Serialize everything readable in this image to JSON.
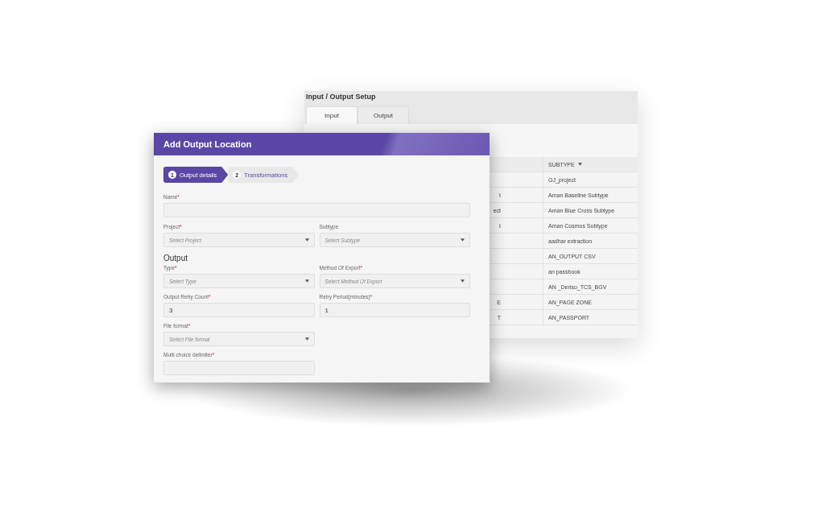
{
  "back_window": {
    "title": "Input / Output Setup",
    "tabs": [
      {
        "label": "Input",
        "selected": true
      },
      {
        "label": "Output",
        "selected": false
      }
    ],
    "table": {
      "subtype_header": "SUBTYPE",
      "rows": [
        {
          "subtype": "GJ_project"
        },
        {
          "column_1": "t",
          "subtype": "Aman Baseline Subtype"
        },
        {
          "column_1": "ect",
          "subtype": "Aman Blue Cross Subtype"
        },
        {
          "column_1": "t",
          "subtype": "Aman Cosmos Subtype"
        },
        {
          "subtype": "aadhar extraction"
        },
        {
          "subtype": "AN_OUTPUT CSV"
        },
        {
          "subtype": "an passbook"
        },
        {
          "subtype": "AN _Deriso_TCS_BGV"
        },
        {
          "column_1": "E",
          "subtype": "AN_PAGE ZONE"
        },
        {
          "column_1": "T",
          "subtype": "AN_PASSPORT"
        }
      ]
    }
  },
  "dialog": {
    "title": "Add Output Location",
    "steps": [
      {
        "number": "1",
        "label": "Output details",
        "selected": true
      },
      {
        "number": "2",
        "label": "Transformations",
        "selected": false
      }
    ],
    "sections": [
      {
        "fields": [
          {
            "kind": "wide_text",
            "label": "Name",
            "required_mark": "*"
          }
        ]
      },
      {
        "fields": [
          {
            "kind": "select",
            "label": "Project",
            "required_mark": "*",
            "placeholder": "Select Project"
          },
          {
            "kind": "select",
            "label": "Subtype",
            "placeholder": "Select Subtype"
          }
        ]
      },
      {
        "heading": "Output",
        "fields": [
          {
            "kind": "select",
            "label": "Type",
            "required_mark": "*",
            "placeholder": "Select Type"
          },
          {
            "kind": "select",
            "label": "Method Of Export",
            "required_mark": "*",
            "placeholder": "Select Method Of Export"
          },
          {
            "kind": "text",
            "label": "Output Retry Count",
            "required_mark": "*",
            "value": "3"
          },
          {
            "kind": "text",
            "label": "Retry Period(minutes)",
            "required_mark": "*",
            "value": "1"
          },
          {
            "kind": "select",
            "label": "File format",
            "required_mark": "*",
            "placeholder": "Select File format"
          },
          {
            "kind": "blank"
          },
          {
            "kind": "text",
            "label": "Multi choice delimiter",
            "required_mark": "*"
          }
        ]
      }
    ]
  }
}
